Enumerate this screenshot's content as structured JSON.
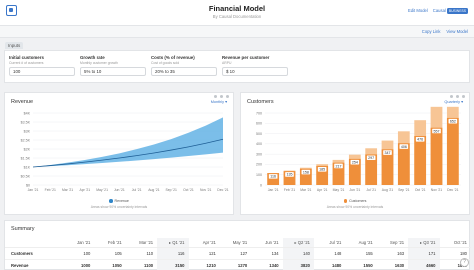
{
  "header": {
    "title": "Financial Model",
    "subtitle": "By Causal Documentation",
    "edit_label": "Edit Model",
    "brand_label": "Causal",
    "badge_label": "BUSINESS"
  },
  "toolbar": {
    "copy_label": "Copy Link",
    "view_label": "View Model"
  },
  "inputs": {
    "tab_label": "Inputs",
    "fields": [
      {
        "label": "Initial customers",
        "sub": "Current # of customers",
        "value": "100"
      },
      {
        "label": "Growth rate",
        "sub": "Monthly customer growth",
        "value": "5% to 10"
      },
      {
        "label": "Costs (% of revenue)",
        "sub": "Cost of goods sold",
        "value": "20% to 35"
      },
      {
        "label": "Revenue per customer",
        "sub": "ARPU",
        "value": "$ 10"
      }
    ]
  },
  "revenue_card": {
    "title": "Revenue",
    "dropdown": "Monthly",
    "legend": "Revenue",
    "note": "Areas show 90% uncertainty intervals",
    "color": "#2f86c8"
  },
  "customers_card": {
    "title": "Customers",
    "dropdown": "Quarterly",
    "legend": "Customers",
    "note": "Areas show 90% uncertainty intervals",
    "color": "#ef8f3a"
  },
  "chart_data": [
    {
      "type": "area",
      "title": "Revenue",
      "x_labels": [
        "Jan '21",
        "Feb '21",
        "Mar '21",
        "Apr '21",
        "May '21",
        "Jun '21",
        "Jul '21",
        "Aug '21",
        "Sep '21",
        "Oct '21",
        "Nov '21",
        "Dec '21"
      ],
      "y_ticks": [
        "$0",
        "$0.5K",
        "$1K",
        "$1.5K",
        "$2K",
        "$2.5K",
        "$3K",
        "$3.5K",
        "$4K"
      ],
      "ylim": [
        0,
        4000
      ],
      "series": [
        {
          "name": "Revenue",
          "values": [
            1000,
            1080,
            1170,
            1270,
            1380,
            1500,
            1630,
            1780,
            1940,
            2120,
            2320,
            2540
          ],
          "lower": [
            1000,
            1050,
            1100,
            1160,
            1220,
            1290,
            1360,
            1440,
            1520,
            1610,
            1700,
            1800
          ],
          "upper": [
            1000,
            1110,
            1240,
            1390,
            1560,
            1760,
            1990,
            2250,
            2550,
            2900,
            3300,
            3760
          ]
        }
      ]
    },
    {
      "type": "bar",
      "title": "Customers",
      "x_labels": [
        "Jan '21",
        "Feb '21",
        "Mar '21",
        "Apr '21",
        "May '21",
        "Jun '21",
        "Jul '21",
        "Aug '21",
        "Sep '21",
        "Oct '21",
        "Nov '21",
        "Dec '21"
      ],
      "y_ticks": [
        "0",
        "100",
        "200",
        "300",
        "400",
        "500",
        "600",
        "700"
      ],
      "ylim": [
        0,
        700
      ],
      "series": [
        {
          "name": "Customers",
          "values": [
            116,
            135,
            158,
            185,
            217,
            254,
            297,
            347,
            406,
            476,
            557,
            652
          ],
          "upper": [
            116,
            140,
            168,
            202,
            244,
            295,
            357,
            432,
            522,
            630,
            760,
            760
          ]
        }
      ],
      "data_labels": [
        "116",
        "135",
        "158",
        "185",
        "217",
        "254",
        "297",
        "347",
        "406",
        "476",
        "557",
        "652"
      ]
    }
  ],
  "summary": {
    "title": "Summary",
    "columns": [
      "Jan '21",
      "Feb '21",
      "Mar '21",
      "Q1 '21",
      "Apr '21",
      "May '21",
      "Jun '21",
      "Q2 '21",
      "Jul '21",
      "Aug '21",
      "Sep '21",
      "Q3 '21",
      "Oct '21"
    ],
    "rows": [
      {
        "label": "Customers",
        "cells": [
          "100",
          "105",
          "110",
          "116",
          "121",
          "127",
          "134",
          "140",
          "148",
          "155",
          "163",
          "171",
          "180"
        ]
      },
      {
        "label": "Revenue",
        "cells": [
          "1000",
          "1050",
          "1100",
          "3150",
          "1210",
          "1270",
          "1340",
          "3820",
          "1480",
          "1550",
          "1630",
          "4660",
          "1800"
        ]
      }
    ]
  }
}
